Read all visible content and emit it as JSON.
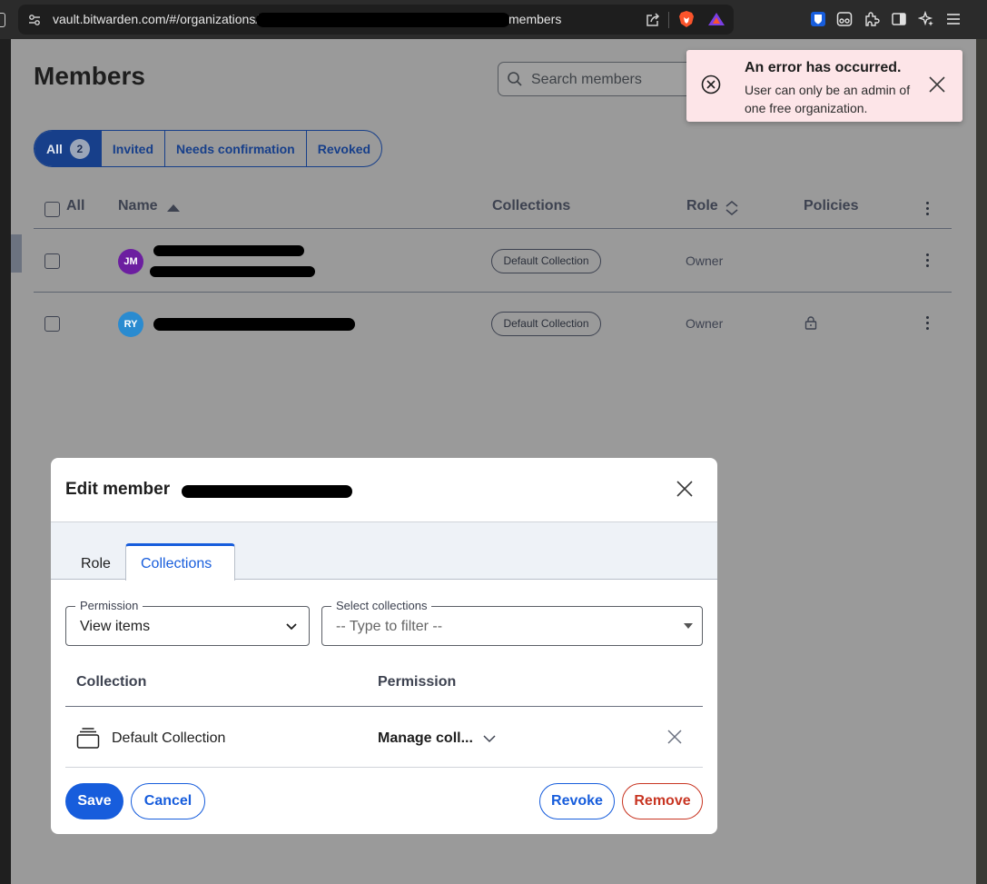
{
  "browser": {
    "url_prefix": "vault.bitwarden.com/#/organizations/",
    "url_suffix": "members",
    "icons": [
      "site-settings-icon",
      "share-icon",
      "brave-shields-icon",
      "brave-rewards-icon",
      "bitwarden-extension-icon",
      "reader-icon",
      "extensions-icon",
      "sidebar-icon",
      "leo-ai-icon",
      "menu-icon"
    ]
  },
  "page": {
    "title": "Members",
    "search_placeholder": "Search members",
    "filters": {
      "all_label": "All",
      "all_count": "2",
      "invited": "Invited",
      "needs_confirmation": "Needs confirmation",
      "revoked": "Revoked"
    },
    "table": {
      "headers": {
        "all": "All",
        "name": "Name",
        "collections": "Collections",
        "role": "Role",
        "policies": "Policies"
      },
      "rows": [
        {
          "initials": "JM",
          "avatar_color": "#6c1ea0",
          "collection": "Default Collection",
          "role": "Owner",
          "policy_lock": false
        },
        {
          "initials": "RY",
          "avatar_color": "#2a8bd0",
          "collection": "Default Collection",
          "role": "Owner",
          "policy_lock": true
        }
      ]
    }
  },
  "toast": {
    "title": "An error has occurred.",
    "message": "User can only be an admin of one free organization."
  },
  "dialog": {
    "title": "Edit member",
    "tabs": {
      "role": "Role",
      "collections": "Collections"
    },
    "permission_field": {
      "legend": "Permission",
      "value": "View items"
    },
    "collections_field": {
      "legend": "Select collections",
      "placeholder": "-- Type to filter --"
    },
    "table": {
      "col_collection": "Collection",
      "col_permission": "Permission",
      "rows": [
        {
          "name": "Default Collection",
          "permission": "Manage coll..."
        }
      ]
    },
    "buttons": {
      "save": "Save",
      "cancel": "Cancel",
      "revoke": "Revoke",
      "remove": "Remove"
    }
  },
  "colors": {
    "accent": "#175ddc",
    "danger": "#c83522",
    "toast_bg": "#fde5e8"
  }
}
